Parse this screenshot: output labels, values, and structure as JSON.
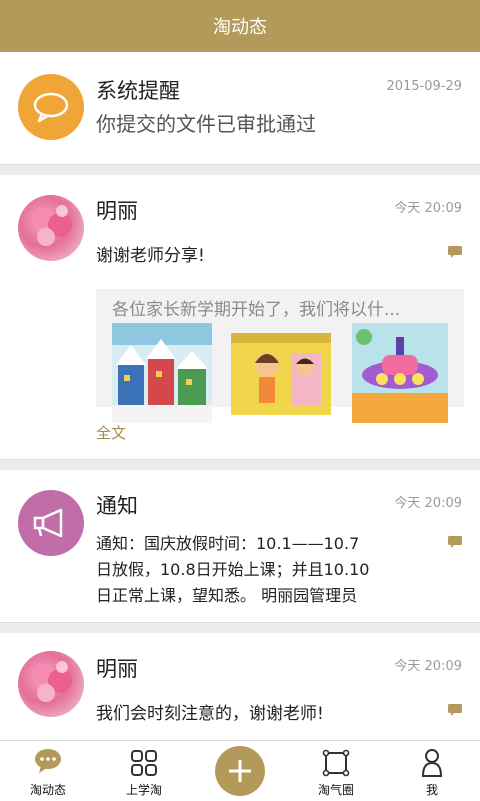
{
  "header": {
    "title": "淘动态"
  },
  "colors": {
    "accent": "#b39a5a",
    "system_orange": "#f0a637",
    "notice_purple": "#c16ea8",
    "link_gold": "#a58c4a"
  },
  "feed": [
    {
      "avatar": "speech-bubble-icon",
      "name": "系统提醒",
      "time": "2015-09-29",
      "text": "你提交的文件已审批通过"
    },
    {
      "avatar": "pink-flower-photo",
      "name": "明丽",
      "time": "今天 20:09",
      "text": "谢谢老师分享!",
      "preview": {
        "text": "各位家长新学期开始了，我们将以什...",
        "images": [
          "winter-town-drawing",
          "yellow-curtain-drawing",
          "space-ship-drawing"
        ]
      },
      "more": "全文"
    },
    {
      "avatar": "megaphone-icon",
      "name": "通知",
      "time": "今天 20:09",
      "lines": [
        "通知：国庆放假时间：10.1——10.7",
        "日放假，10.8日开始上课；并且10.10",
        "日正常上课，望知悉。 明丽园管理员"
      ]
    },
    {
      "avatar": "pink-flower-photo",
      "name": "明丽",
      "time": "今天 20:09",
      "text": "我们会时刻注意的，谢谢老师!"
    }
  ],
  "tabs": [
    {
      "label": "淘动态",
      "icon": "chat-bubble-icon",
      "active": true
    },
    {
      "label": "上学淘",
      "icon": "grid-icon"
    },
    {
      "label": "",
      "icon": "plus-icon"
    },
    {
      "label": "淘气圈",
      "icon": "frame-icon"
    },
    {
      "label": "我",
      "icon": "person-icon"
    }
  ]
}
